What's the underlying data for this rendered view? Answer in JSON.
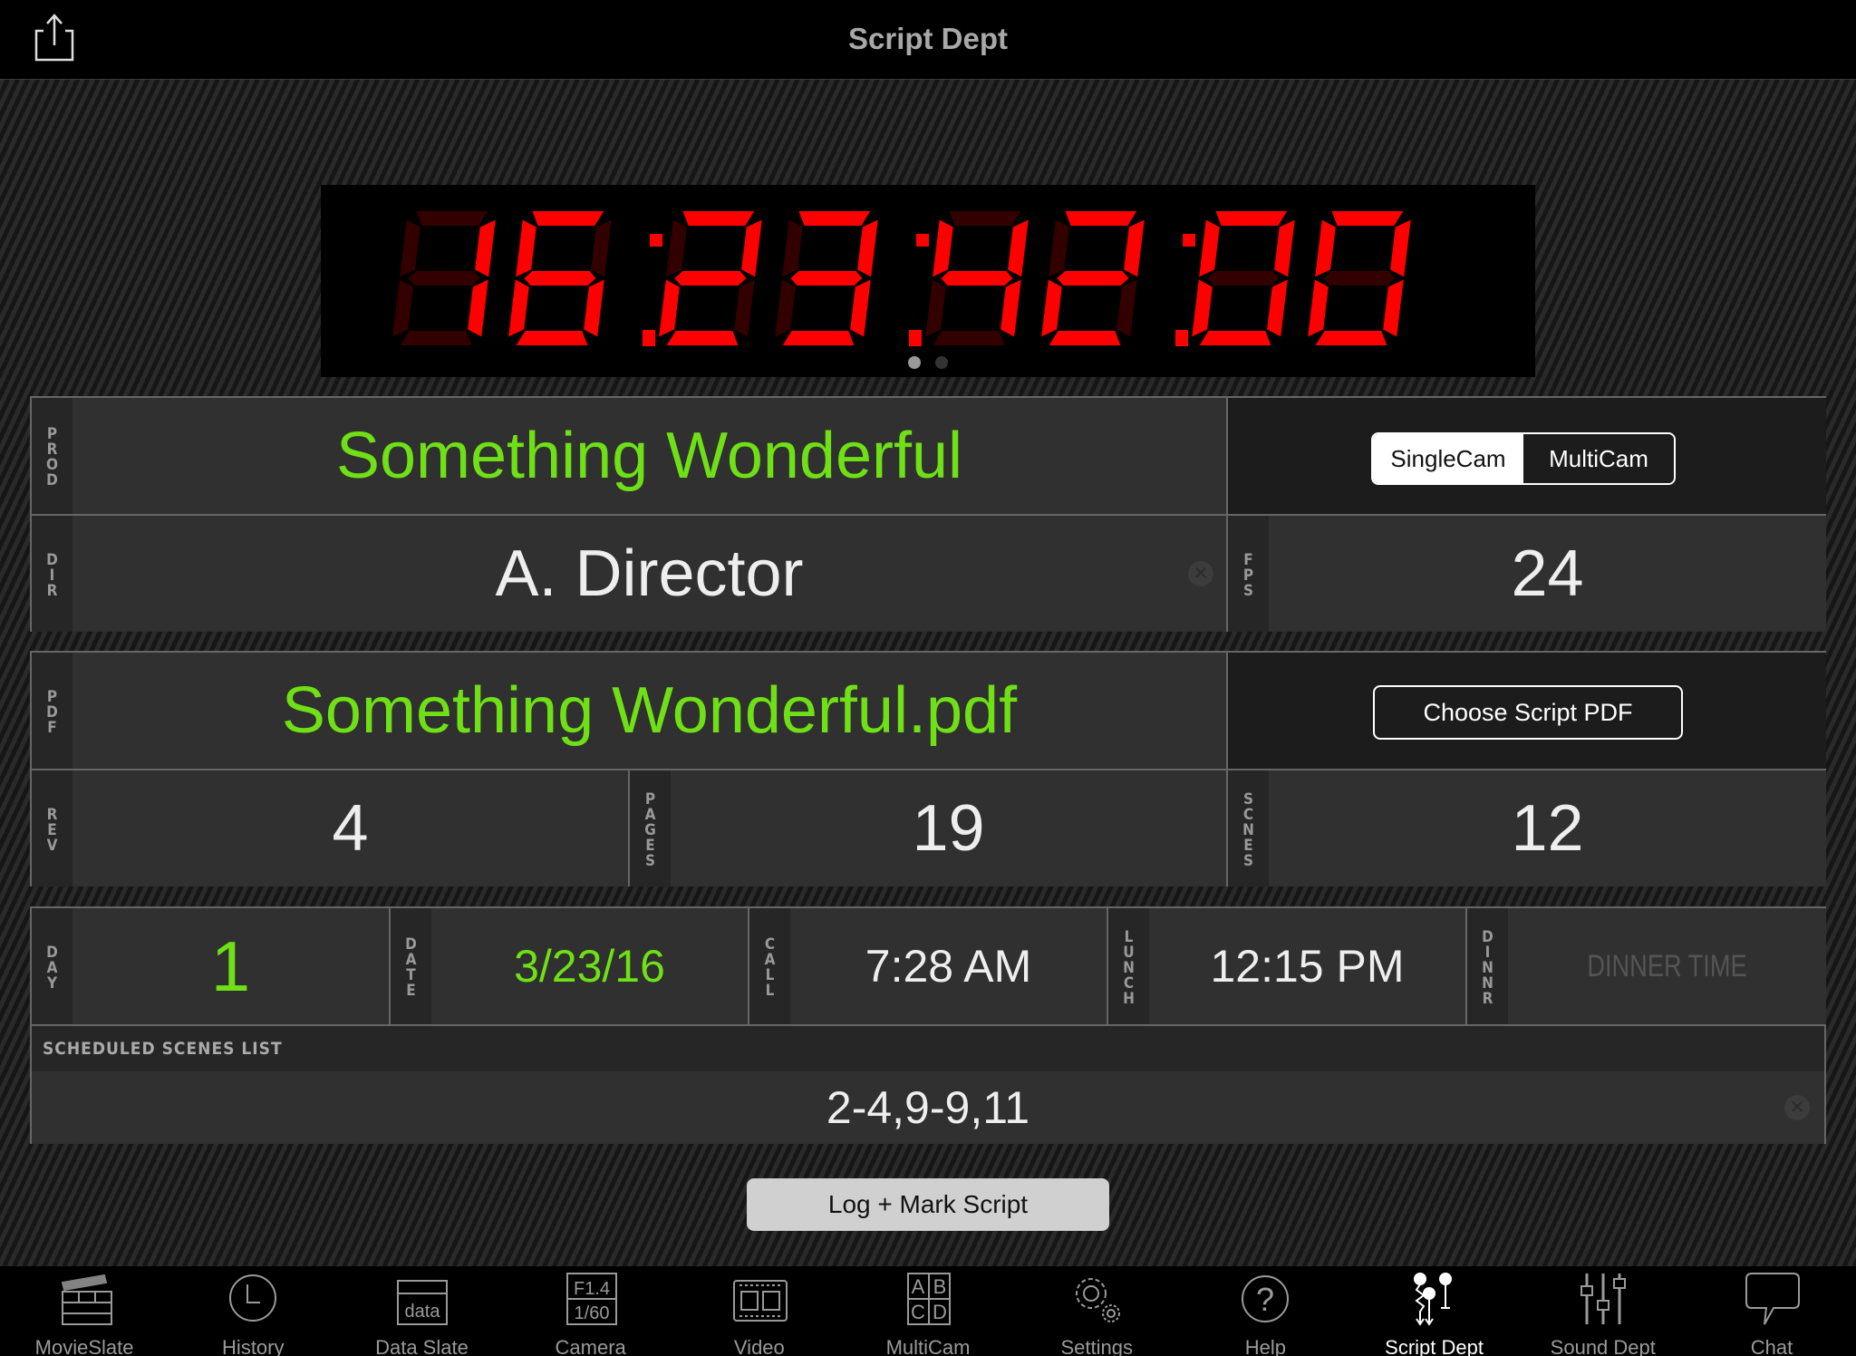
{
  "header": {
    "title": "Script Dept",
    "share_icon": "share-icon"
  },
  "timecode": {
    "value": "16:23:42:00",
    "page_count": 2,
    "active_page": 0,
    "color": "#ff0000",
    "dim_color": "#330000"
  },
  "production": {
    "prod_label": "PROD",
    "prod_value": "Something Wonderful",
    "mode_options": [
      "SingleCam",
      "MultiCam"
    ],
    "mode_selected": "SingleCam",
    "dir_label": "DIR",
    "dir_value": "A. Director",
    "fps_label": "FPS",
    "fps_value": "24"
  },
  "script": {
    "pdf_label": "PDF",
    "pdf_value": "Something Wonderful.pdf",
    "choose_button": "Choose Script PDF",
    "rev_label": "REV",
    "rev_value": "4",
    "pages_label": "PAGES",
    "pages_value": "19",
    "scenes_label": "SCNES",
    "scenes_value": "12"
  },
  "schedule": {
    "day_label": "DAY",
    "day_value": "1",
    "date_label": "DATE",
    "date_value": "3/23/16",
    "call_label": "CALL",
    "call_value": "7:28 AM",
    "lunch_label": "LUNCH",
    "lunch_value": "12:15 PM",
    "dinner_label": "DINNR",
    "dinner_placeholder": "DINNER TIME",
    "scenes_list_label": "SCHEDULED SCENES LIST",
    "scenes_list_value": "2-4,9-9,11"
  },
  "log_button": "Log + Mark Script",
  "colors": {
    "accent_green": "#6fe016",
    "timecode_red": "#ff0000"
  },
  "tabs": [
    {
      "label": "MovieSlate",
      "icon": "clapperboard-icon"
    },
    {
      "label": "History",
      "icon": "clock-icon"
    },
    {
      "label": "Data Slate",
      "icon": "data-slate-icon"
    },
    {
      "label": "Camera",
      "icon": "camera-settings-icon",
      "top": "F1.4",
      "bottom": "1/60"
    },
    {
      "label": "Video",
      "icon": "film-icon"
    },
    {
      "label": "MultiCam",
      "icon": "multicam-grid-icon"
    },
    {
      "label": "Settings",
      "icon": "gears-icon"
    },
    {
      "label": "Help",
      "icon": "help-icon"
    },
    {
      "label": "Script Dept",
      "icon": "script-pins-icon",
      "active": true
    },
    {
      "label": "Sound Dept",
      "icon": "mixer-sliders-icon"
    },
    {
      "label": "Chat",
      "icon": "chat-bubble-icon"
    }
  ]
}
